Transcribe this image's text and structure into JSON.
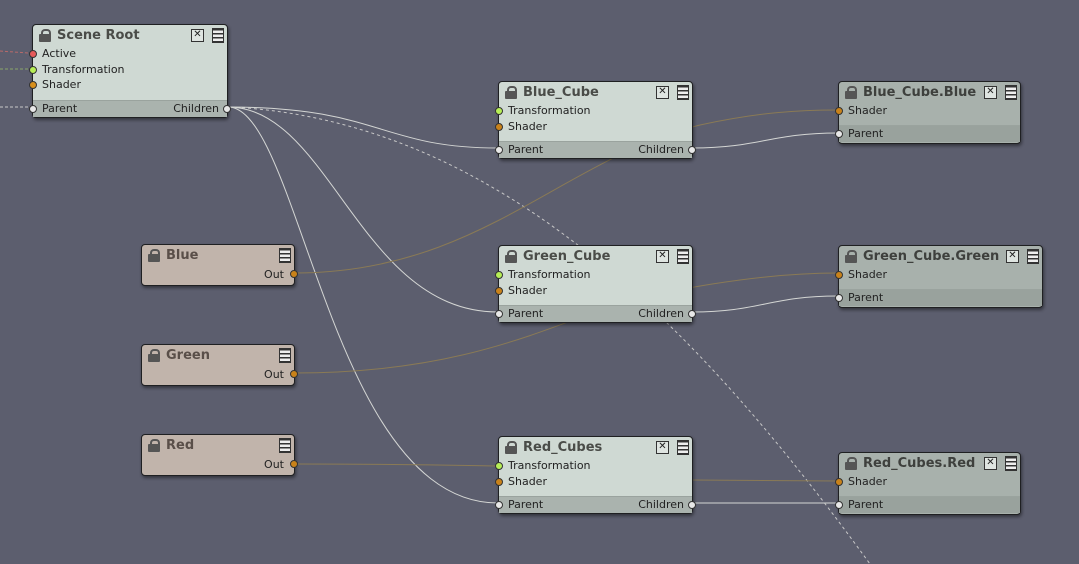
{
  "colors": {
    "background": "#5c5e6e",
    "node_body": "#cfd9d3",
    "tail_node_body": "#a8b1ac",
    "color_node_body": "#c1b4ab",
    "wire_white": "#d4d6d4",
    "wire_brown": "#8a7a55"
  },
  "scene_root": {
    "title": "Scene Root",
    "ports": [
      "Active",
      "Transformation",
      "Shader"
    ],
    "parent": "Parent",
    "children": "Children"
  },
  "blue_cube": {
    "title": "Blue_Cube",
    "ports": [
      "Transformation",
      "Shader"
    ],
    "parent": "Parent",
    "children": "Children"
  },
  "green_cube": {
    "title": "Green_Cube",
    "ports": [
      "Transformation",
      "Shader"
    ],
    "parent": "Parent",
    "children": "Children"
  },
  "red_cubes": {
    "title": "Red_Cubes",
    "ports": [
      "Transformation",
      "Shader"
    ],
    "parent": "Parent",
    "children": "Children"
  },
  "blue_cube_blue": {
    "title": "Blue_Cube.Blue",
    "shader": "Shader",
    "parent": "Parent"
  },
  "green_cube_green": {
    "title": "Green_Cube.Green",
    "shader": "Shader",
    "parent": "Parent"
  },
  "red_cubes_red": {
    "title": "Red_Cubes.Red",
    "shader": "Shader",
    "parent": "Parent"
  },
  "blue": {
    "title": "Blue",
    "out": "Out"
  },
  "green": {
    "title": "Green",
    "out": "Out"
  },
  "red": {
    "title": "Red",
    "out": "Out"
  }
}
